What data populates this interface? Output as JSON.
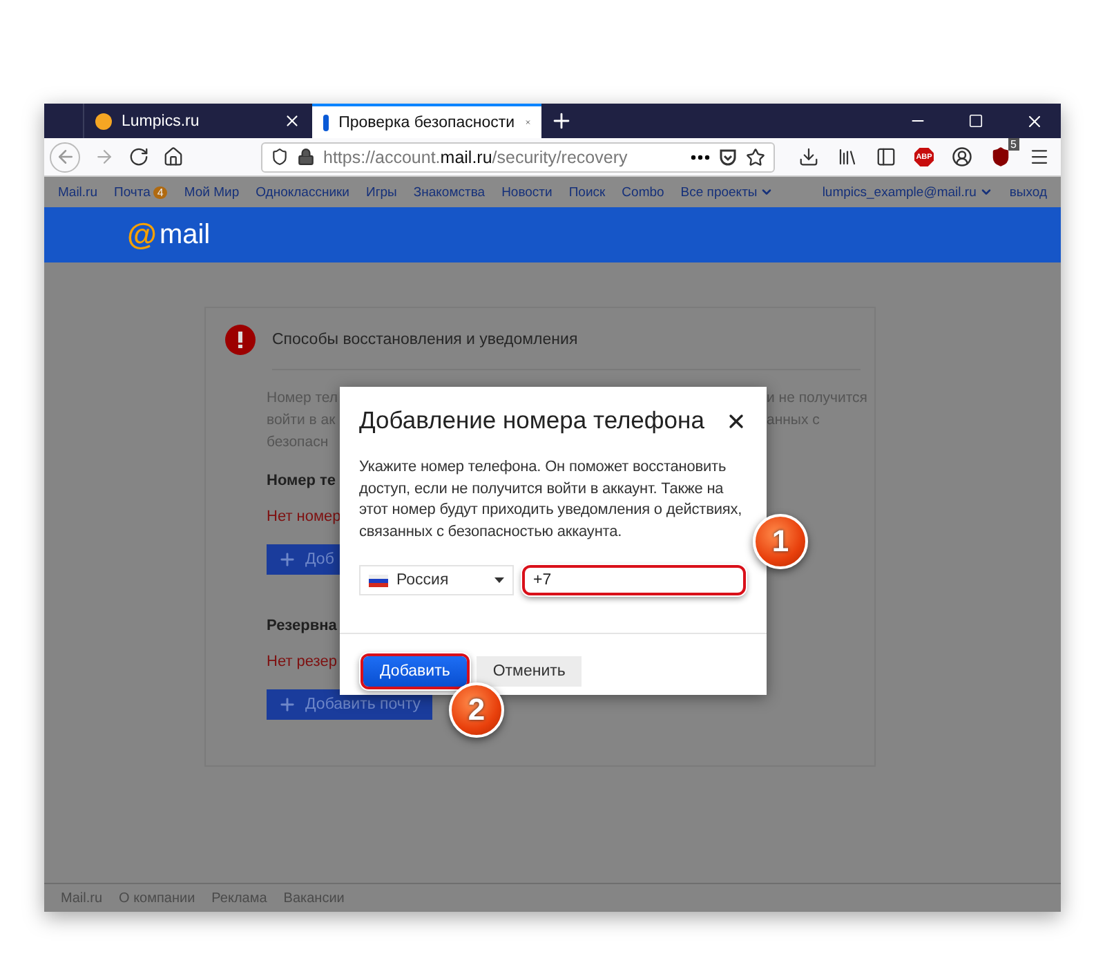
{
  "browser": {
    "tabs": [
      {
        "title": "Lumpics.ru",
        "kind": "site",
        "selected": false
      },
      {
        "title": "Проверка безопасности",
        "kind": "mail",
        "selected": true
      }
    ],
    "url": {
      "scheme": "https://account.",
      "domain": "mail.ru",
      "path": "/security/recovery"
    },
    "extensions": [
      {
        "kind": "abp",
        "label": "ABP"
      },
      {
        "kind": "account"
      },
      {
        "kind": "ublock",
        "badge": "5"
      }
    ]
  },
  "portal_nav": {
    "items": [
      {
        "label": "Mail.ru"
      },
      {
        "label": "Почта",
        "badge": "4"
      },
      {
        "label": "Мой Мир"
      },
      {
        "label": "Одноклассники"
      },
      {
        "label": "Игры"
      },
      {
        "label": "Знакомства"
      },
      {
        "label": "Новости"
      },
      {
        "label": "Поиск"
      },
      {
        "label": "Combo"
      },
      {
        "label": "Все проекты",
        "dropdown": true
      }
    ],
    "user": {
      "label": "lumpics_example@mail.ru",
      "dropdown": true
    },
    "logout": "выход"
  },
  "logo": {
    "symbol": "@",
    "text": "mail"
  },
  "card": {
    "title": "Способы восстановления и уведомления",
    "description_rows": [
      {
        "left": "Номер тел",
        "right": "и не получится"
      },
      {
        "left": "войти в ак",
        "right": "анных с"
      },
      {
        "left": "безопасн"
      }
    ],
    "sections": [
      {
        "heading": "Номер те",
        "status": "Нет номер",
        "button": "Доб"
      },
      {
        "heading": "Резервна",
        "status": "Нет резер",
        "button": "Добавить почту"
      }
    ]
  },
  "dialog": {
    "title": "Добавление номера телефона",
    "text": "Укажите номер телефона. Он поможет восстановить доступ, если не получится войти в аккаунт. Также на этот номер будут приходить уведомления о действиях, связанных с безопасностью аккаунта.",
    "country": "Россия",
    "phone": {
      "value": "+7",
      "highlighted": true
    },
    "buttons": [
      {
        "label": "Добавить",
        "kind": "primary",
        "highlighted": true
      },
      {
        "label": "Отменить",
        "kind": "secondary",
        "highlighted": false
      }
    ]
  },
  "callouts": [
    {
      "label": "1"
    },
    {
      "label": "2"
    }
  ],
  "footer": {
    "links": [
      "Mail.ru",
      "О компании",
      "Реклама",
      "Вакансии"
    ]
  }
}
